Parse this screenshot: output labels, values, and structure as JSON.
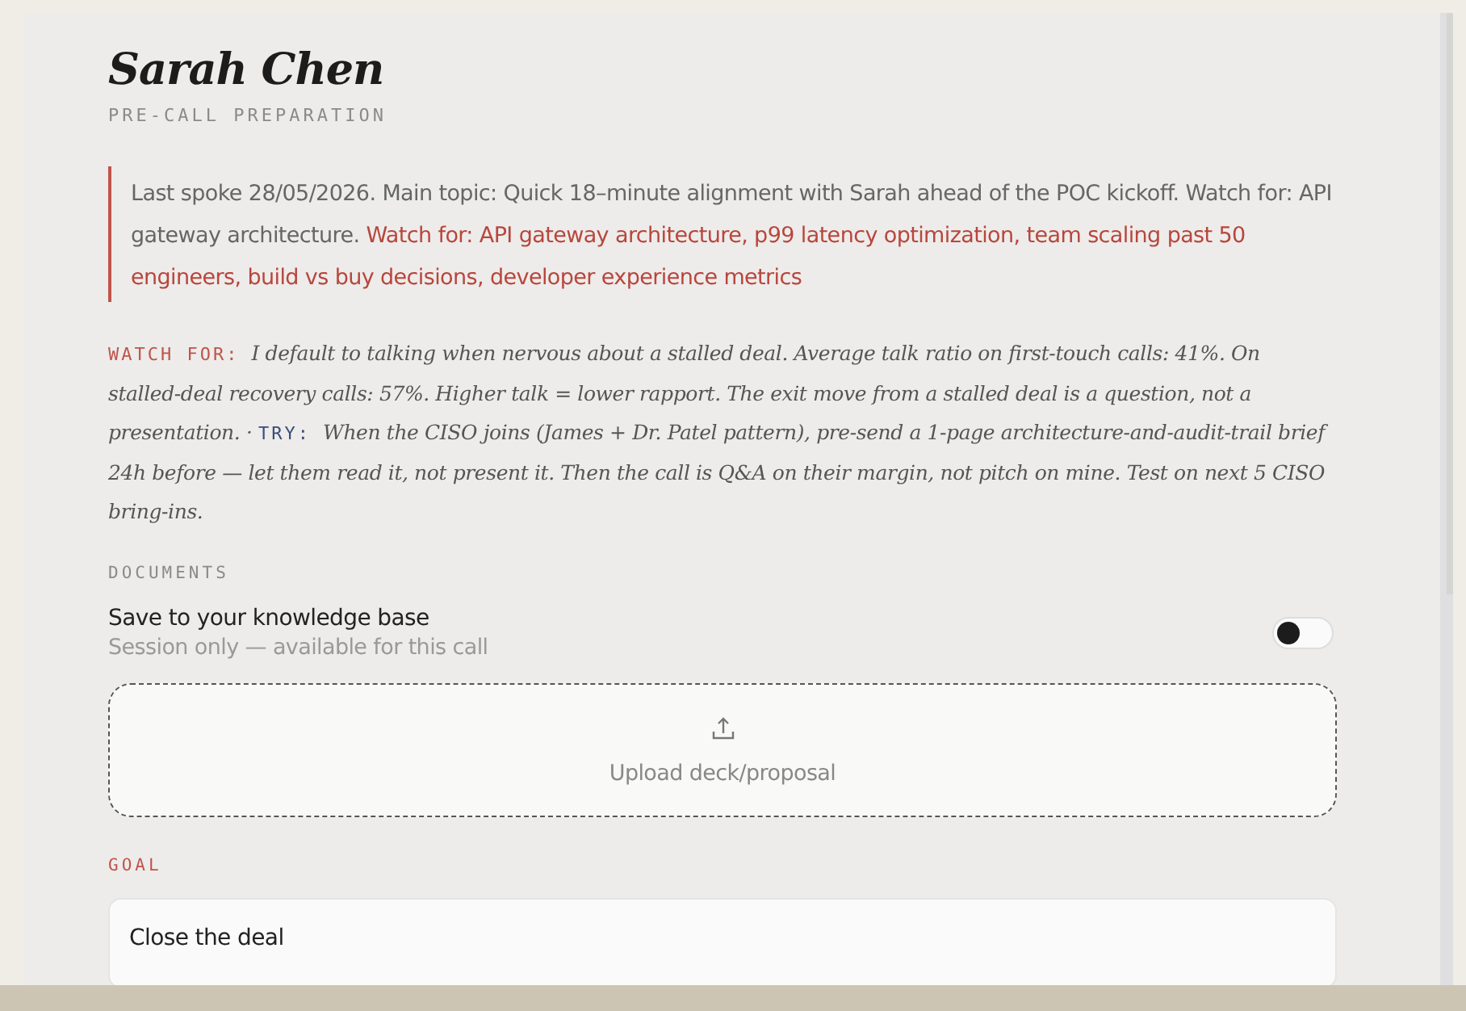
{
  "header": {
    "name": "Sarah Chen",
    "subtitle": "PRE-CALL PREPARATION"
  },
  "summary": {
    "text": "Last spoke 28/05/2026. Main topic: Quick 18–minute alignment with Sarah ahead of the POC kickoff. Watch for: API gateway architecture.",
    "highlight": "Watch for: API gateway architecture, p99 latency optimization, team scaling past 50 engineers, build vs buy decisions, developer experience metrics"
  },
  "coaching_separator": "·",
  "coaching": [
    {
      "kind": "watch",
      "label": "WATCH FOR:",
      "text": "I default to talking when nervous about a stalled deal. Average talk ratio on first-touch calls: 41%. On stalled-deal recovery calls: 57%. Higher talk = lower rapport. The exit move from a stalled deal is a question, not a presentation."
    },
    {
      "kind": "try",
      "label": "TRY:",
      "text": "When the CISO joins (James + Dr. Patel pattern), pre-send a 1-page architecture-and-audit-trail brief 24h before — let them read it, not present it. Then the call is Q&A on their margin, not pitch on mine. Test on next 5 CISO bring-ins."
    }
  ],
  "documents": {
    "heading": "DOCUMENTS",
    "save_label": "Save to your knowledge base",
    "save_hint": "Session only — available for this call",
    "save_on": false,
    "upload_label": "Upload deck/proposal"
  },
  "goal": {
    "heading": "GOAL",
    "value": "Close the deal"
  }
}
